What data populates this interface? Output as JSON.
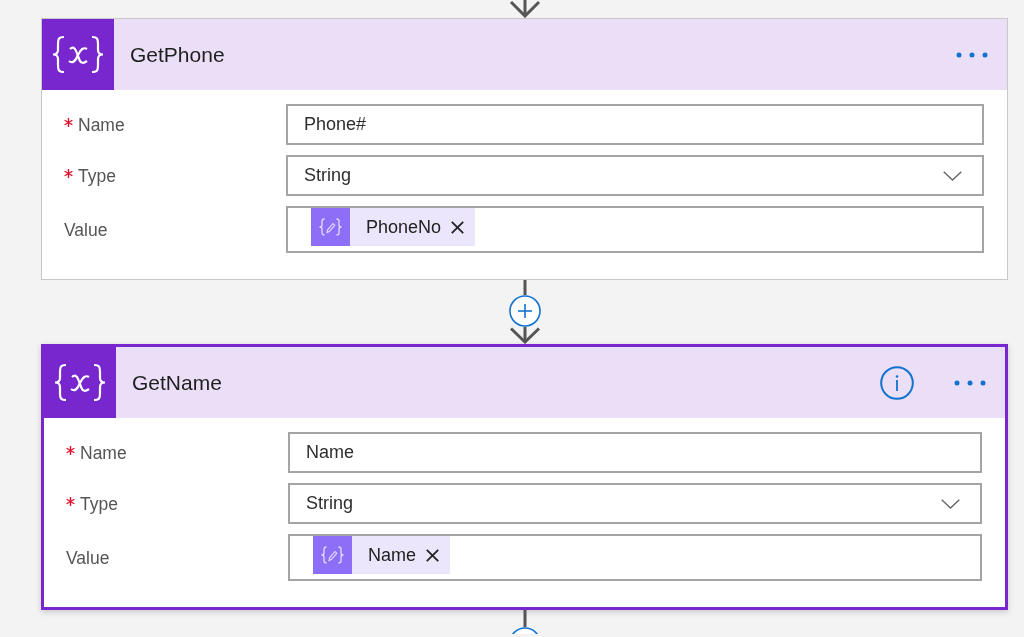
{
  "cards": [
    {
      "title": "GetPhone",
      "selected": false,
      "info": false,
      "fields": [
        {
          "kind": "text",
          "label": "Name",
          "required": true,
          "value": "Phone#"
        },
        {
          "kind": "dropdown",
          "label": "Type",
          "required": true,
          "value": "String"
        },
        {
          "kind": "tokens",
          "label": "Value",
          "required": false,
          "tokens": [
            "PhoneNo"
          ]
        }
      ]
    },
    {
      "title": "GetName",
      "selected": true,
      "info": true,
      "fields": [
        {
          "kind": "text",
          "label": "Name",
          "required": true,
          "value": "Name"
        },
        {
          "kind": "dropdown",
          "label": "Type",
          "required": true,
          "value": "String"
        },
        {
          "kind": "tokens",
          "label": "Value",
          "required": false,
          "tokens": [
            "Name"
          ]
        }
      ]
    }
  ]
}
